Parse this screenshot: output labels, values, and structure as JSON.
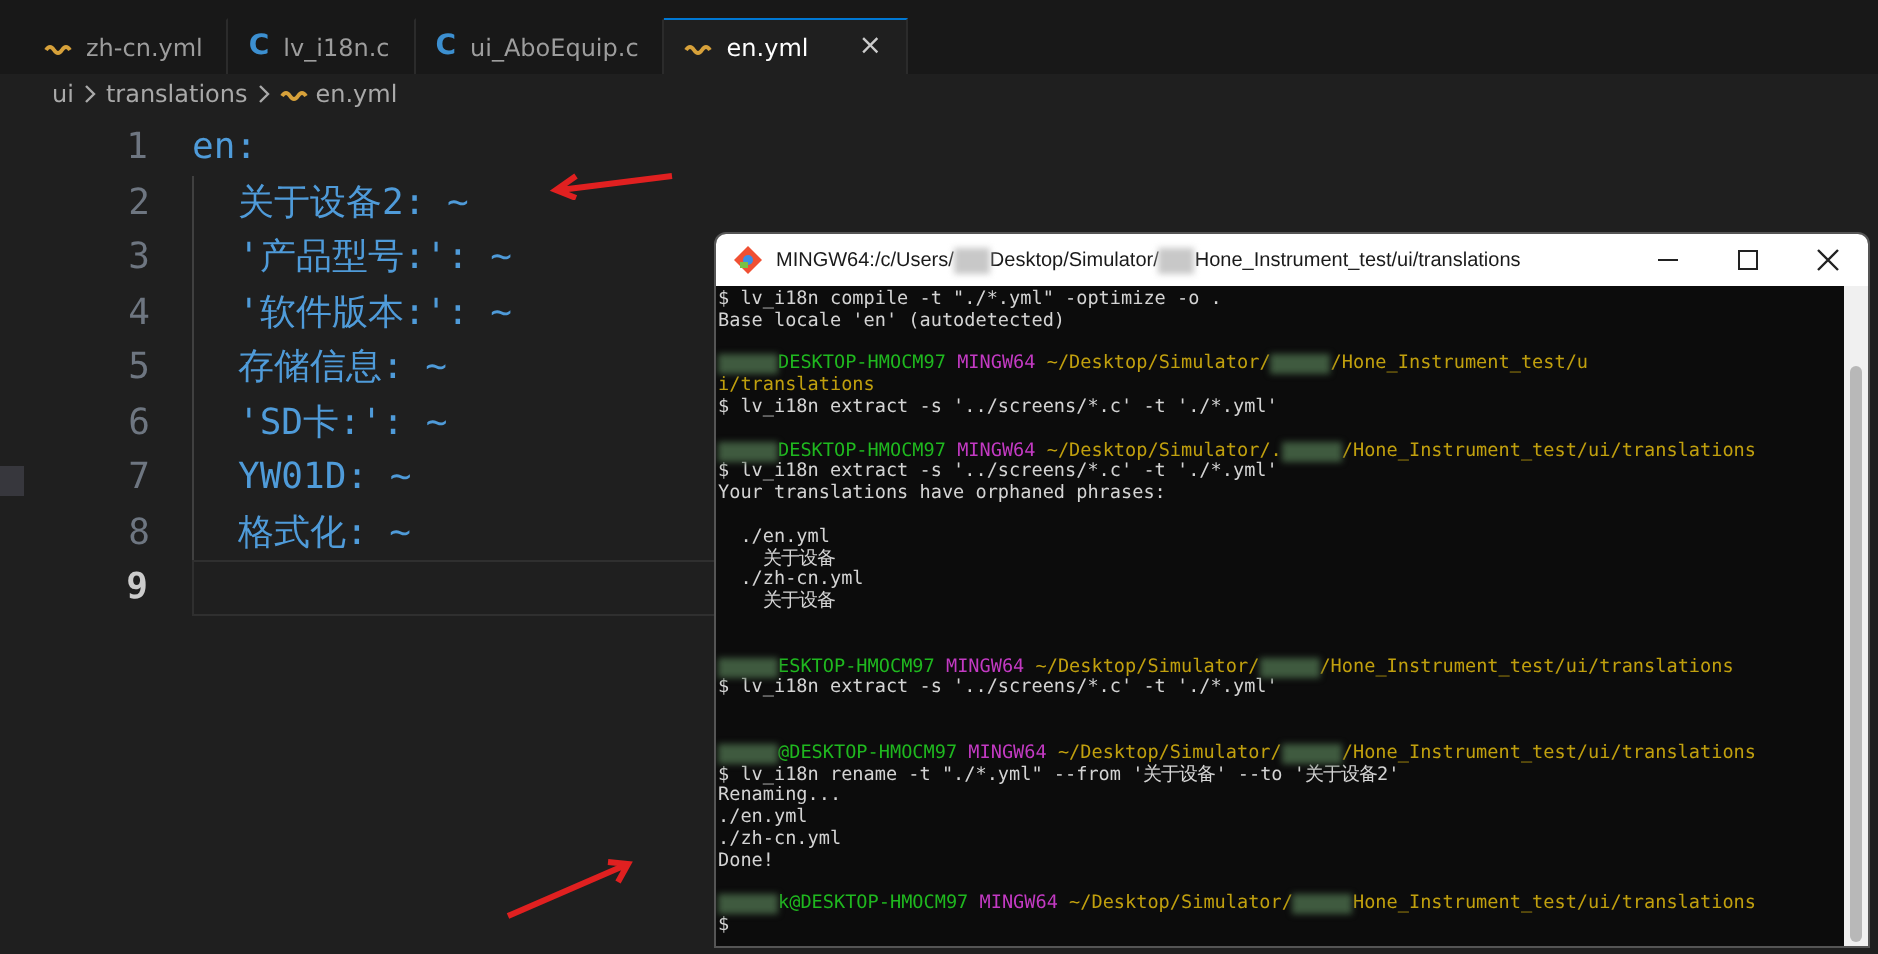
{
  "editor": {
    "tabs": [
      {
        "label": "zh-cn.yml",
        "kind": "yaml",
        "selected": false
      },
      {
        "label": "lv_i18n.c",
        "kind": "c",
        "glyph": "C",
        "selected": false
      },
      {
        "label": "ui_AboEquip.c",
        "kind": "c",
        "glyph": "C",
        "selected": false
      },
      {
        "label": "en.yml",
        "kind": "yaml",
        "selected": true,
        "close": "×"
      }
    ],
    "breadcrumb": [
      {
        "label": "ui",
        "kind": "folder"
      },
      {
        "label": "translations",
        "kind": "folder"
      },
      {
        "label": "en.yml",
        "kind": "yaml"
      }
    ],
    "lines": [
      {
        "number": "1",
        "text": "en:",
        "current": false,
        "children": [
          {
            "number": "2",
            "text": "关于设备2: ~",
            "current": false
          },
          {
            "number": "3",
            "text": "'产品型号:': ~",
            "current": false
          },
          {
            "number": "4",
            "text": "'软件版本:': ~",
            "current": false
          },
          {
            "number": "5",
            "text": "存储信息: ~",
            "current": false
          },
          {
            "number": "6",
            "text": "'SD卡:': ~",
            "current": false
          },
          {
            "number": "7",
            "text": "YW01D: ~",
            "current": false
          },
          {
            "number": "8",
            "text": "格式化: ~",
            "current": false
          }
        ]
      },
      {
        "number": "9",
        "current": true
      }
    ]
  },
  "terminal": {
    "title": [
      {
        "kind": "text",
        "text": "MINGW64:/c/Users/"
      },
      {
        "kind": "redacted"
      },
      {
        "kind": "text",
        "text": "Desktop/Simulator/"
      },
      {
        "kind": "redacted"
      },
      {
        "kind": "text",
        "text": "Hone_Instrument_test/ui/translations"
      }
    ],
    "lines": [
      {
        "segments": [
          {
            "kind": "out",
            "text": "$ lv_i18n compile -t \"./*.yml\" -optimize -o ."
          }
        ]
      },
      {
        "segments": [
          {
            "kind": "out",
            "text": "Base locale 'en' (autodetected)"
          }
        ]
      },
      {
        "kind": "blank"
      },
      {
        "segments": [
          {
            "kind": "redacted"
          },
          {
            "kind": "user",
            "text": "DESKTOP-HMOCM97 "
          },
          {
            "kind": "shell",
            "text": "MINGW64 "
          },
          {
            "kind": "path",
            "text": "~/Desktop/Simulator/"
          },
          {
            "kind": "redacted"
          },
          {
            "kind": "path",
            "text": "/Hone_Instrument_test/u"
          }
        ]
      },
      {
        "segments": [
          {
            "kind": "path",
            "text": "i/translations"
          }
        ]
      },
      {
        "segments": [
          {
            "kind": "out",
            "text": "$ lv_i18n extract -s '../screens/*.c' -t './*.yml'"
          }
        ]
      },
      {
        "kind": "blank"
      },
      {
        "segments": [
          {
            "kind": "redacted"
          },
          {
            "kind": "user",
            "text": "DESKTOP-HMOCM97 "
          },
          {
            "kind": "shell",
            "text": "MINGW64 "
          },
          {
            "kind": "path",
            "text": "~/Desktop/Simulator/."
          },
          {
            "kind": "redacted"
          },
          {
            "kind": "path",
            "text": "/Hone_Instrument_test/ui/translations"
          }
        ]
      },
      {
        "segments": [
          {
            "kind": "out",
            "text": "$ lv_i18n extract -s '../screens/*.c' -t './*.yml'"
          }
        ]
      },
      {
        "segments": [
          {
            "kind": "out",
            "text": "Your translations have orphaned phrases:"
          }
        ]
      },
      {
        "kind": "blank"
      },
      {
        "segments": [
          {
            "kind": "out",
            "text": "  ./en.yml"
          }
        ]
      },
      {
        "segments": [
          {
            "kind": "out",
            "text": "    关于设备"
          }
        ]
      },
      {
        "segments": [
          {
            "kind": "out",
            "text": "  ./zh-cn.yml"
          }
        ]
      },
      {
        "segments": [
          {
            "kind": "out",
            "text": "    关于设备"
          }
        ]
      },
      {
        "kind": "blank"
      },
      {
        "kind": "blank"
      },
      {
        "segments": [
          {
            "kind": "redacted"
          },
          {
            "kind": "user",
            "text": "ESKTOP-HMOCM97 "
          },
          {
            "kind": "shell",
            "text": "MINGW64 "
          },
          {
            "kind": "path",
            "text": "~/Desktop/Simulator/"
          },
          {
            "kind": "redacted"
          },
          {
            "kind": "path",
            "text": "/Hone_Instrument_test/ui/translations"
          }
        ]
      },
      {
        "segments": [
          {
            "kind": "out",
            "text": "$ lv_i18n extract -s '../screens/*.c' -t './*.yml'"
          }
        ]
      },
      {
        "kind": "blank"
      },
      {
        "kind": "blank"
      },
      {
        "segments": [
          {
            "kind": "redacted"
          },
          {
            "kind": "user",
            "text": "@DESKTOP-HMOCM97 "
          },
          {
            "kind": "shell",
            "text": "MINGW64 "
          },
          {
            "kind": "path",
            "text": "~/Desktop/Simulator/"
          },
          {
            "kind": "redacted"
          },
          {
            "kind": "path",
            "text": "/Hone_Instrument_test/ui/translations"
          }
        ]
      },
      {
        "segments": [
          {
            "kind": "out",
            "text": "$ lv_i18n rename -t \"./*.yml\" --from '关于设备' --to '关于设备2'"
          }
        ]
      },
      {
        "segments": [
          {
            "kind": "out",
            "text": "Renaming..."
          }
        ]
      },
      {
        "segments": [
          {
            "kind": "out",
            "text": "./en.yml"
          }
        ]
      },
      {
        "segments": [
          {
            "kind": "out",
            "text": "./zh-cn.yml"
          }
        ]
      },
      {
        "segments": [
          {
            "kind": "out",
            "text": "Done!"
          }
        ]
      },
      {
        "kind": "blank"
      },
      {
        "segments": [
          {
            "kind": "redacted"
          },
          {
            "kind": "user",
            "text": "k@DESKTOP-HMOCM97 "
          },
          {
            "kind": "shell",
            "text": "MINGW64 "
          },
          {
            "kind": "path",
            "text": "~/Desktop/Simulator/"
          },
          {
            "kind": "redacted"
          },
          {
            "kind": "path",
            "text": "Hone_Instrument_test/ui/translations"
          }
        ]
      },
      {
        "segments": [
          {
            "kind": "out",
            "text": "$"
          }
        ]
      }
    ]
  }
}
